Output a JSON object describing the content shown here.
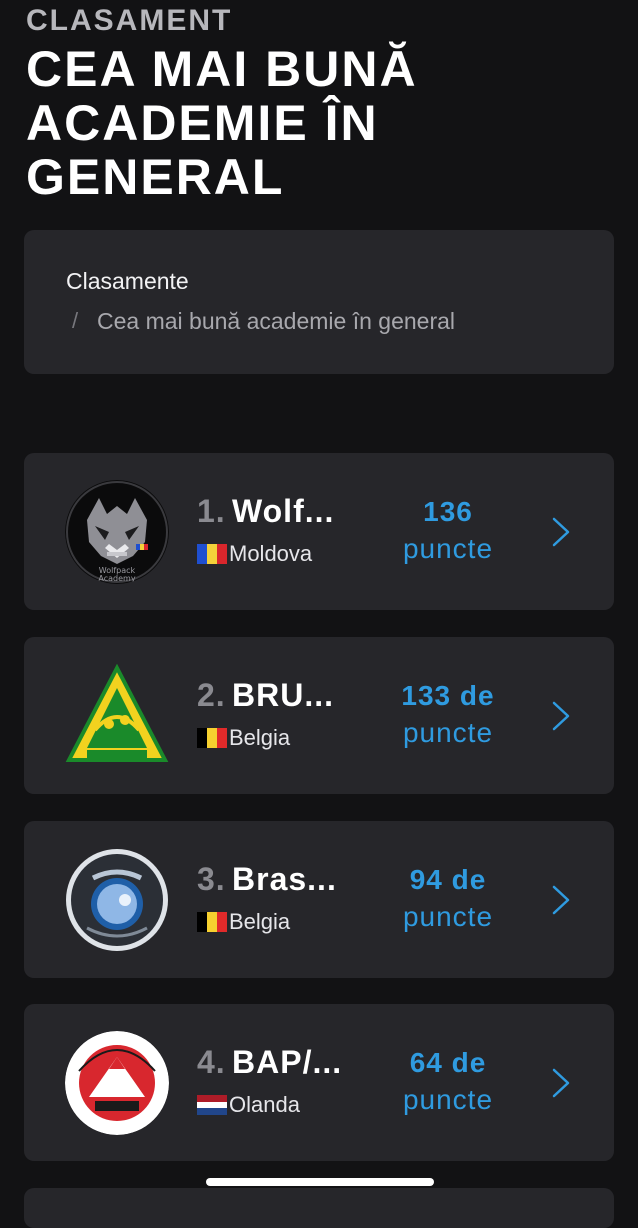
{
  "header": {
    "eyebrow": "CLASAMENT",
    "title": "CEA MAI BUNĂ ACADEMIE ÎN GENERAL"
  },
  "breadcrumb": {
    "root": "Clasamente",
    "separator": "/",
    "current": "Cea mai bună academie în general"
  },
  "colors": {
    "background": "#121214",
    "card": "#26262a",
    "accent": "#2f9be0"
  },
  "rankings": [
    {
      "rank": "1.",
      "name": "Wolf...",
      "country": "Moldova",
      "flag": "moldova-flag-icon",
      "points_line1": "136",
      "points_line2": "puncte",
      "logo": "wolfpack-academy-logo"
    },
    {
      "rank": "2.",
      "name": "BRU...",
      "country": "Belgia",
      "flag": "belgium-flag-icon",
      "points_line1": "133 de",
      "points_line2": "puncte",
      "logo": "brazilian-jiu-jitsu-logo"
    },
    {
      "rank": "3.",
      "name": "Bras...",
      "country": "Belgia",
      "flag": "belgium-flag-icon",
      "points_line1": "94 de",
      "points_line2": "puncte",
      "logo": "brasa-logo"
    },
    {
      "rank": "4.",
      "name": "BAP/...",
      "country": "Olanda",
      "flag": "netherlands-flag-icon",
      "points_line1": "64 de",
      "points_line2": "puncte",
      "logo": "budo-academy-physical-logo"
    }
  ]
}
